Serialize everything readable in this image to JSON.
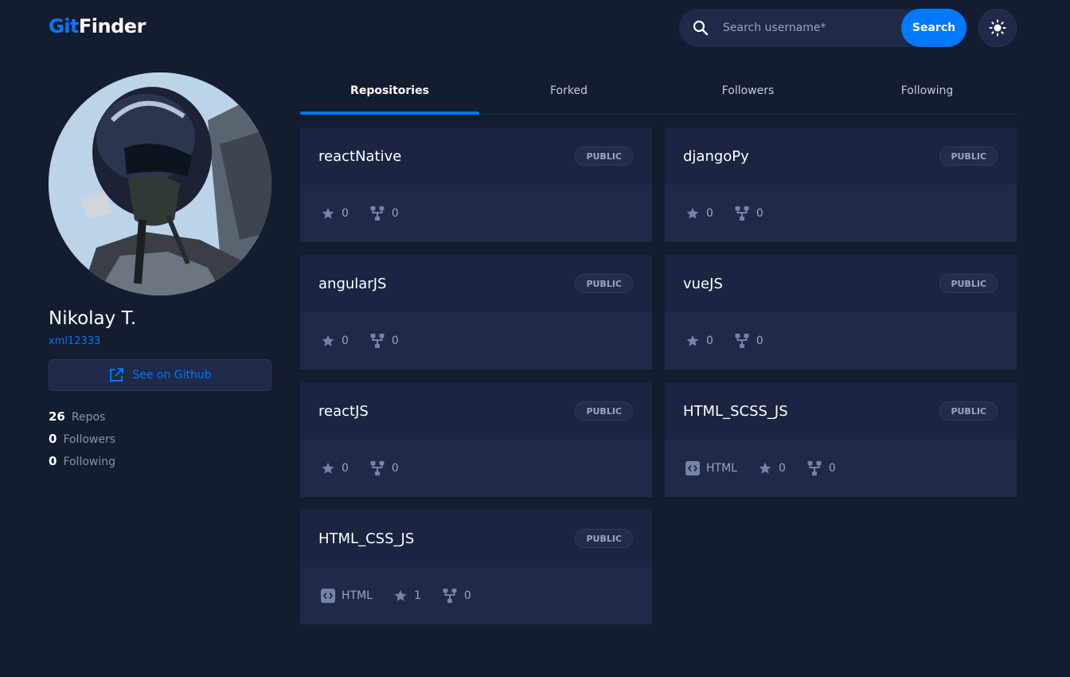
{
  "header": {
    "logo_part1": "Git",
    "logo_part2": "Finder",
    "search_placeholder": "Search username*",
    "search_button": "Search",
    "theme_icon": "sun-icon"
  },
  "profile": {
    "name": "Nikolay T.",
    "login": "xml12333",
    "github_button": "See on Github",
    "stats": [
      {
        "value": "26",
        "label": "Repos"
      },
      {
        "value": "0",
        "label": "Followers"
      },
      {
        "value": "0",
        "label": "Following"
      }
    ]
  },
  "tabs": [
    {
      "label": "Repositories",
      "active": true
    },
    {
      "label": "Forked",
      "active": false
    },
    {
      "label": "Followers",
      "active": false
    },
    {
      "label": "Following",
      "active": false
    }
  ],
  "repos": [
    {
      "name": "reactNative",
      "badge": "PUBLIC",
      "language": "",
      "stars": "0",
      "forks": "0"
    },
    {
      "name": "djangoPy",
      "badge": "PUBLIC",
      "language": "",
      "stars": "0",
      "forks": "0"
    },
    {
      "name": "angularJS",
      "badge": "PUBLIC",
      "language": "",
      "stars": "0",
      "forks": "0"
    },
    {
      "name": "vueJS",
      "badge": "PUBLIC",
      "language": "",
      "stars": "0",
      "forks": "0"
    },
    {
      "name": "reactJS",
      "badge": "PUBLIC",
      "language": "",
      "stars": "0",
      "forks": "0"
    },
    {
      "name": "HTML_SCSS_JS",
      "badge": "PUBLIC",
      "language": "HTML",
      "stars": "0",
      "forks": "0"
    },
    {
      "name": "HTML_CSS_JS",
      "badge": "PUBLIC",
      "language": "HTML",
      "stars": "1",
      "forks": "0"
    }
  ],
  "colors": {
    "background": "#141c2f",
    "card": "#1f2a48",
    "accent": "#0079ff",
    "muted": "#9aa5c2"
  }
}
